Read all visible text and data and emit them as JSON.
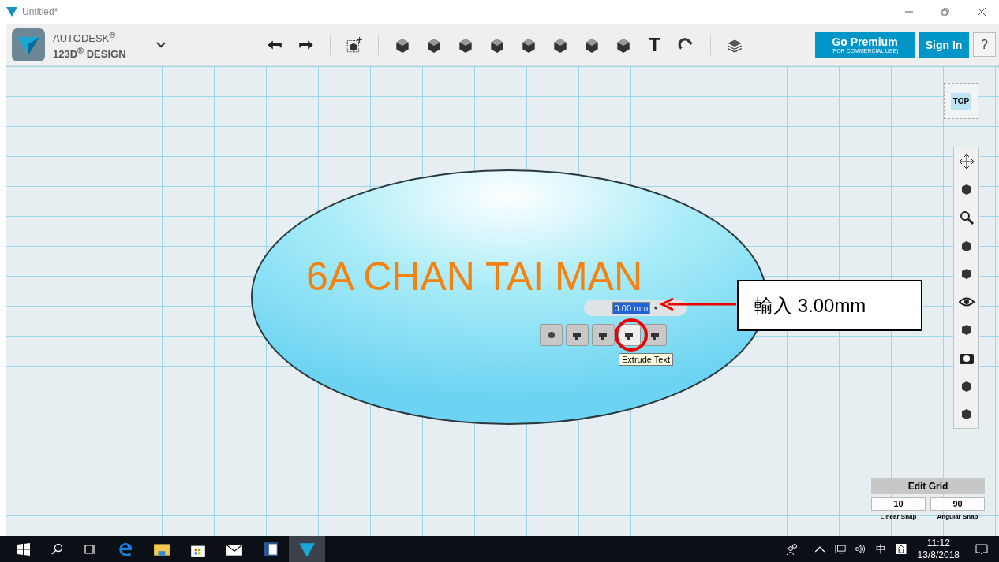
{
  "window": {
    "title": "Untitled*"
  },
  "brand": {
    "line_1": "AUTODESK$^{®}$",
    "line_2": "123D$^{®}$ DESIGN"
  },
  "toolbar": {
    "text_tool": "T"
  },
  "account": {
    "premium": "Go Premium",
    "premium_note": "(FOR COMMERCIAL USE)",
    "sign_in": "Sign In",
    "help": "?"
  },
  "view_cube": {
    "face": "TOP"
  },
  "canvas": {
    "text": "6A CHAN TAI MAN",
    "extrude_value": "0.00 mm",
    "tooltip": "Extrude Text",
    "callout": "輸入 3.00mm"
  },
  "mini_tools": [
    {
      "selected": false
    },
    {
      "selected": false
    },
    {
      "selected": false
    },
    {
      "selected": true
    },
    {
      "selected": false
    }
  ],
  "edit_grid": {
    "title": "Edit Grid",
    "linear": "10",
    "linear_label": "Linear Snap",
    "angular": "90",
    "angular_label": "Angular Snap"
  },
  "taskbar": {
    "apps": [
      {
        "selected": false
      },
      {
        "selected": false
      },
      {
        "selected": false
      },
      {
        "selected": false
      },
      {
        "selected": false
      },
      {
        "selected": true
      }
    ],
    "ime": "中",
    "time": "11:12",
    "date": "13/8/2018"
  }
}
